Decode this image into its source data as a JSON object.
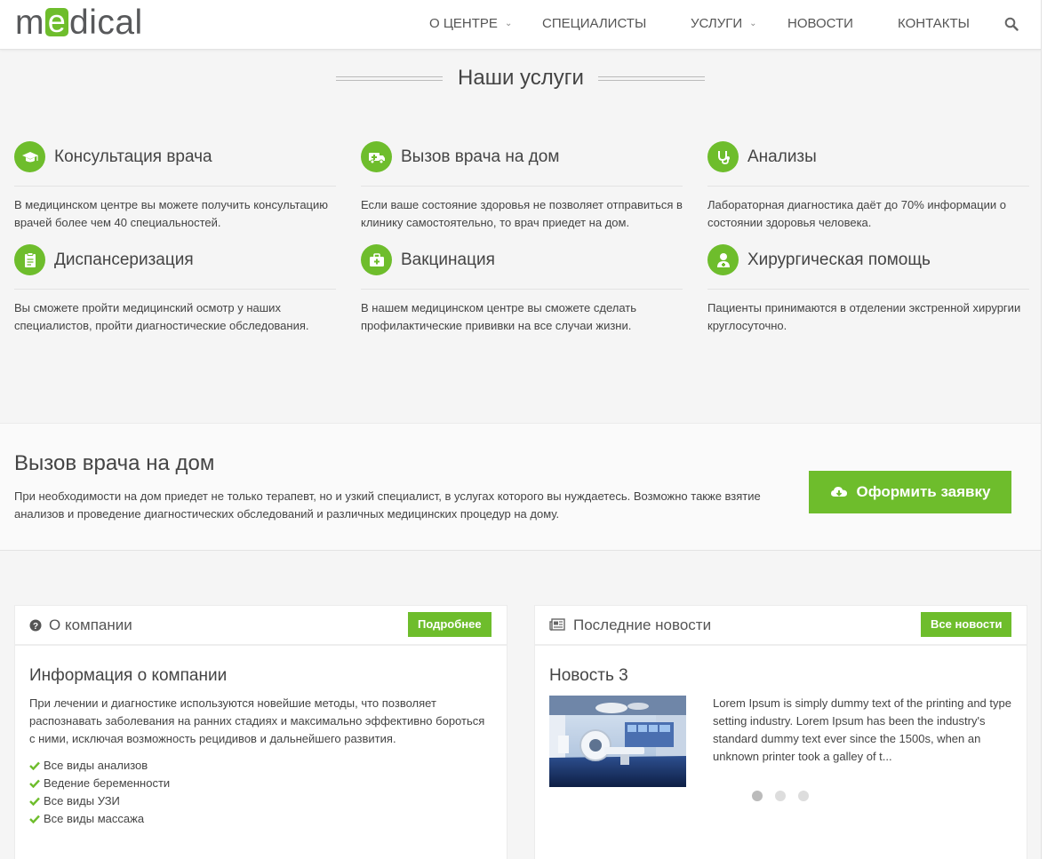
{
  "header": {
    "logo": {
      "before": "m",
      "accent": "e",
      "after": "dical"
    },
    "nav": [
      {
        "label": "О ЦЕНТРЕ",
        "dropdown": true
      },
      {
        "label": "СПЕЦИАЛИСТЫ",
        "dropdown": false
      },
      {
        "label": "УСЛУГИ",
        "dropdown": true
      },
      {
        "label": "НОВОСТИ",
        "dropdown": false
      },
      {
        "label": "КОНТАКТЫ",
        "dropdown": false
      }
    ],
    "search_icon": "search-icon"
  },
  "services_section": {
    "title": "Наши услуги",
    "items": [
      {
        "title": "Консультация врача",
        "icon": "graduation-cap-icon",
        "desc": "В медицинском центре вы можете получить консультацию врачей более чем 40 специальностей."
      },
      {
        "title": "Вызов врача на дом",
        "icon": "ambulance-icon",
        "desc": "Если ваше состояние здоровья не позволяет отправиться в клинику самостоятельно, то врач приедет на дом."
      },
      {
        "title": "Анализы",
        "icon": "stethoscope-icon",
        "desc": "Лабораторная диагностика даёт до 70% информации о состоянии здоровья человека."
      },
      {
        "title": "Диспансеризация",
        "icon": "clipboard-icon",
        "desc": "Вы сможете пройти медицинский осмотр у наших специалистов, пройти диагностические обследования."
      },
      {
        "title": "Вакцинация",
        "icon": "medkit-icon",
        "desc": "В нашем медицинском центре вы сможете сделать профилактические прививки на все случаи жизни."
      },
      {
        "title": "Хирургическая помощь",
        "icon": "user-md-icon",
        "desc": "Пациенты принимаются в отделении экстренной хирургии круглосуточно."
      }
    ]
  },
  "cta": {
    "title": "Вызов врача на дом",
    "text": "При необходимости на дом приедет не только терапевт, но и узкий специалист, в услугах которого вы нуждаетесь. Возможно также взятие анализов и проведение диагностических обследований и различных медицинских процедур на дому.",
    "button_label": "Оформить заявку",
    "button_icon": "cloud-download-icon"
  },
  "about_panel": {
    "title": "О компании",
    "icon": "question-circle-icon",
    "button_label": "Подробнее",
    "heading": "Информация о компании",
    "text": "При лечении и диагностике используются новейшие методы, что позволяет распознавать заболевания на ранних стадиях и максимально эффективно бороться с ними, исключая возможность рецидивов и дальнейшего развития.",
    "list": [
      "Все виды анализов",
      "Ведение беременности",
      "Все виды УЗИ",
      "Все виды массажа"
    ]
  },
  "news_panel": {
    "title": "Последние новости",
    "icon": "newspaper-icon",
    "button_label": "Все новости",
    "news_title": "Новость 3",
    "news_text": "Lorem Ipsum is simply dummy text of the printing and type setting industry. Lorem Ipsum has been the industry's standard dummy text ever since the 1500s, when an unknown printer took a galley of t...",
    "slider": {
      "count": 3,
      "active": 1
    }
  },
  "colors": {
    "accent": "#6ebd2c",
    "text": "#444444",
    "background": "#f5f5f5"
  }
}
